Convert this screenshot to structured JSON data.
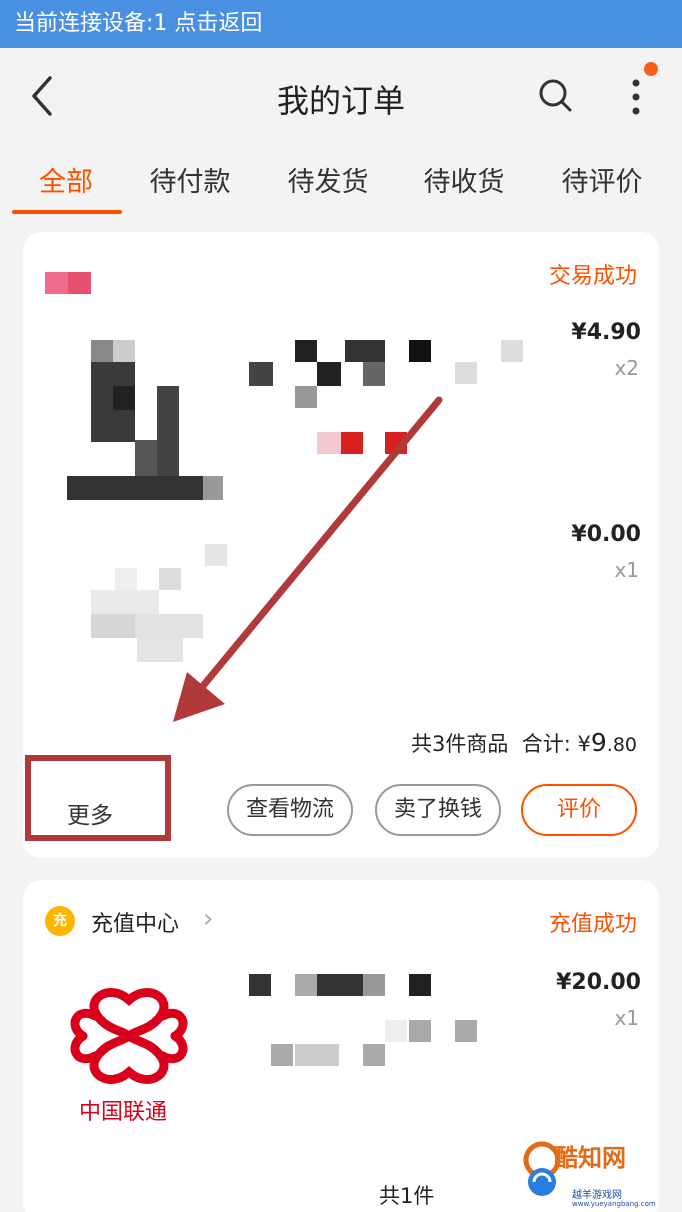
{
  "connection_bar": {
    "text": "当前连接设备:1 点击返回"
  },
  "header": {
    "title": "我的订单",
    "back_icon": "back-arrow-icon",
    "search_icon": "search-icon",
    "more_icon": "more-vertical-icon"
  },
  "tabs": [
    {
      "label": "全部",
      "active": true
    },
    {
      "label": "待付款",
      "active": false
    },
    {
      "label": "待发货",
      "active": false
    },
    {
      "label": "待收货",
      "active": false
    },
    {
      "label": "待评价",
      "active": false
    }
  ],
  "orders": [
    {
      "status": "交易成功",
      "items": [
        {
          "price": "¥4.90",
          "qty": "x2"
        },
        {
          "price": "¥0.00",
          "qty": "x1"
        }
      ],
      "summary": {
        "count_text": "共3件商品",
        "total_label": "合计:",
        "currency": "¥",
        "total_int": "9",
        "total_dec": ".80"
      },
      "more_label": "更多",
      "actions": [
        "查看物流",
        "卖了换钱",
        "评价"
      ]
    },
    {
      "store_name": "充值中心",
      "store_icon_text": "充",
      "status": "充值成功",
      "items": [
        {
          "price": "¥20.00",
          "qty": "x1"
        }
      ],
      "logo_text": "中国联通",
      "footer_partial": "共1件"
    }
  ],
  "watermark": {
    "main": "酷知网",
    "sub": "越羊游戏网",
    "url": "www.yueyangbang.com"
  },
  "colors": {
    "accent": "#ff5000",
    "conn_bar": "#4a90e2",
    "annotation": "#b03a3a",
    "unicom_red": "#d9001b"
  }
}
